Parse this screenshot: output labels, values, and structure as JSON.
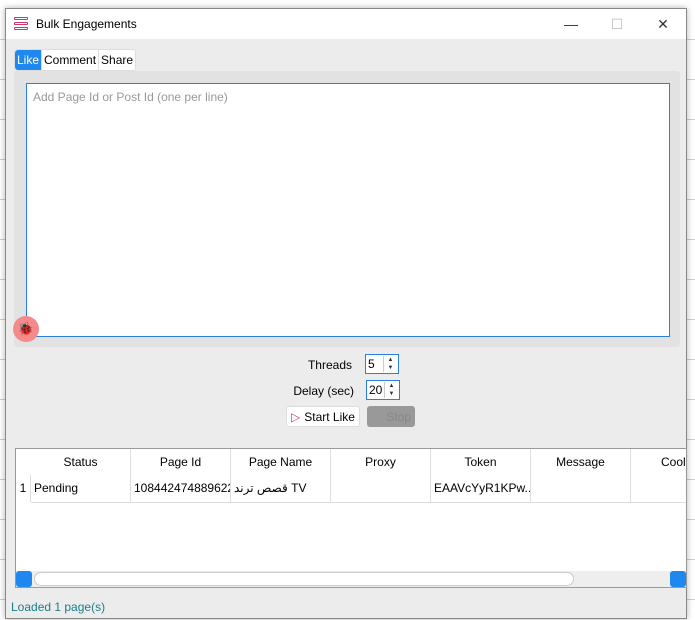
{
  "window": {
    "title": "Bulk Engagements",
    "minimize": "—",
    "maximize": "☐",
    "close": "✕"
  },
  "tabs": [
    {
      "label": "Like",
      "active": true
    },
    {
      "label": "Comment"
    },
    {
      "label": "Share"
    }
  ],
  "input": {
    "placeholder": "Add Page Id or Post Id (one per line)",
    "value": ""
  },
  "controls": {
    "threads_label": "Threads",
    "threads_value": "5",
    "delay_label": "Delay (sec)",
    "delay_value": "20",
    "start_label": "Start Like",
    "stop_label": "Stop"
  },
  "table": {
    "columns": [
      "Status",
      "Page Id",
      "Page Name",
      "Proxy",
      "Token",
      "Message",
      "Cool"
    ],
    "rows": [
      {
        "num": "1",
        "cells": [
          "Pending",
          "108442474889622",
          "قصص ترند TV",
          "",
          "EAAVcYyR1KPw...",
          "",
          ""
        ]
      }
    ]
  },
  "status": "Loaded 1 page(s)",
  "colors": {
    "accent": "#1e88f0",
    "status_text": "#1a7f8a",
    "icon": "#d6336c"
  }
}
